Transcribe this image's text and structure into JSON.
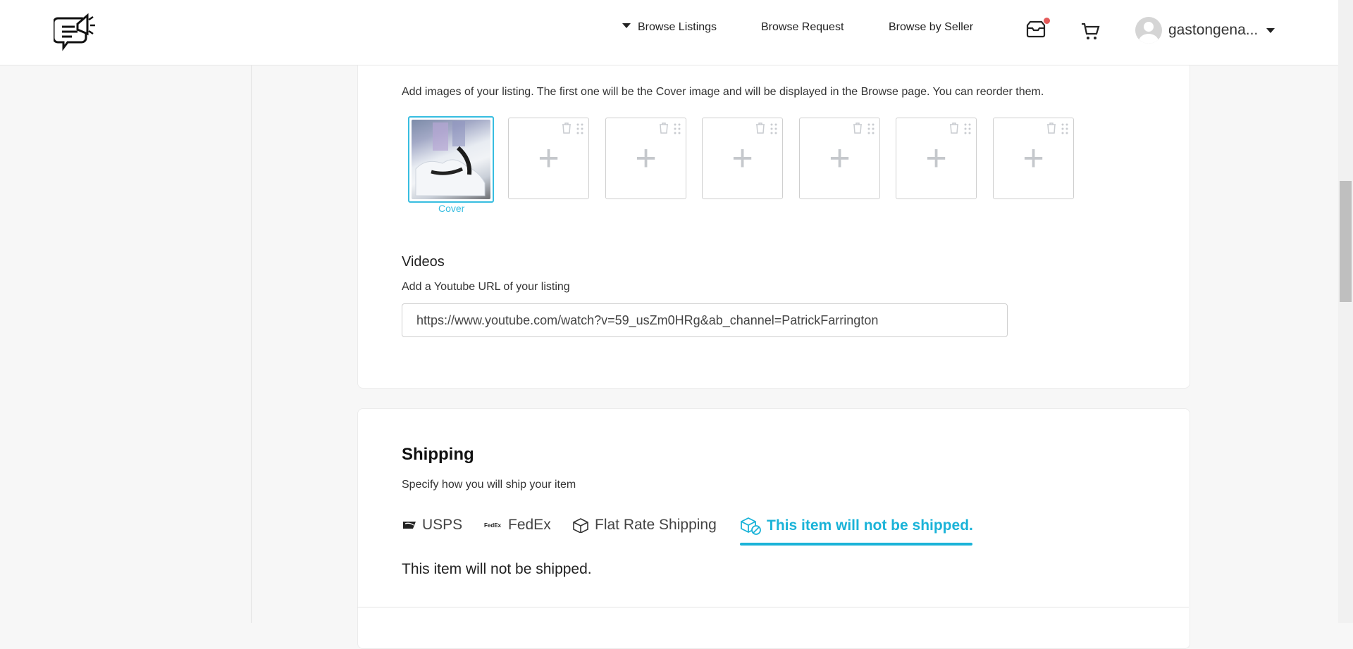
{
  "header": {
    "nav": {
      "browse_listings": "Browse Listings",
      "browse_request": "Browse Request",
      "browse_by_seller": "Browse by Seller"
    },
    "icons": [
      "logo-icon",
      "inbox-icon",
      "cart-icon",
      "avatar"
    ],
    "username": "gastongena...",
    "notification_dot_color": "#e45a5a"
  },
  "media": {
    "description": "Add images of your listing. The first one will be the Cover image and will be displayed in the Browse page. You can reorder them.",
    "cover_label": "Cover",
    "empty_slots": 6
  },
  "videos": {
    "title": "Videos",
    "description": "Add a Youtube URL of your listing",
    "url_value": "https://www.youtube.com/watch?v=59_usZm0HRg&ab_channel=PatrickFarrington"
  },
  "shipping": {
    "title": "Shipping",
    "description": "Specify how you will ship your item",
    "tabs": [
      {
        "label": "USPS",
        "icon": "usps-icon"
      },
      {
        "label": "FedEx",
        "icon": "fedex-icon"
      },
      {
        "label": "Flat Rate Shipping",
        "icon": "box-icon"
      },
      {
        "label": "This item will not be shipped.",
        "icon": "no-ship-icon",
        "active": true
      }
    ],
    "selected_message": "This item will not be shipped.",
    "accent_color": "#1ab3d8"
  }
}
